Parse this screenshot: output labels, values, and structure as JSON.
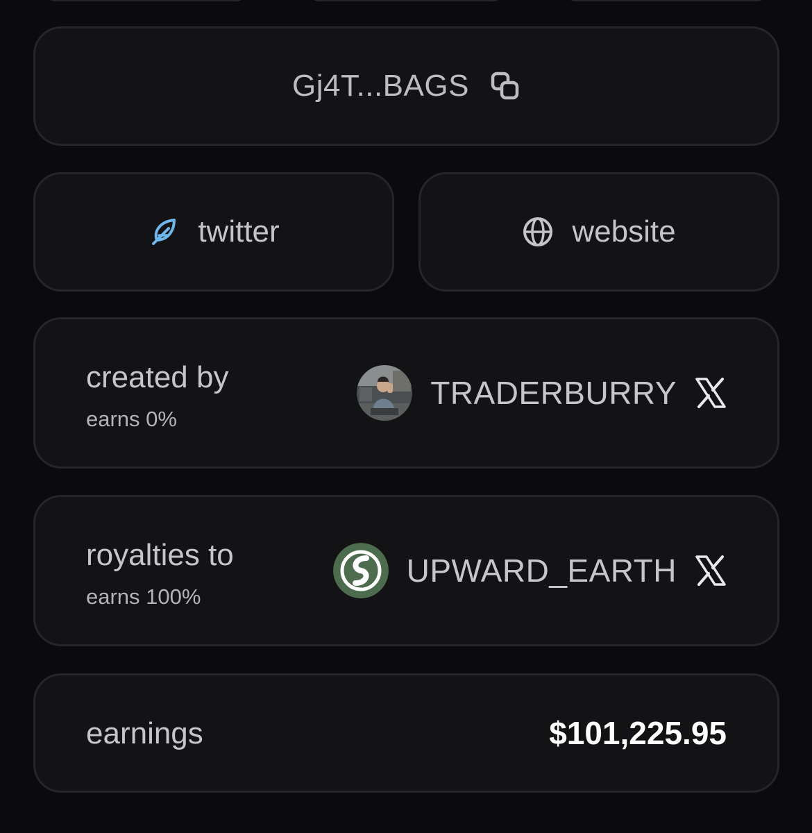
{
  "address": {
    "short": "Gj4T...BAGS",
    "copy_icon": "copy-icon"
  },
  "links": {
    "twitter": {
      "label": "twitter",
      "icon": "feather-icon",
      "icon_color": "#6fb7ea"
    },
    "website": {
      "label": "website",
      "icon": "globe-icon"
    }
  },
  "creator": {
    "role_label": "created by",
    "earns": "earns 0%",
    "username": "TRADERBURRY",
    "social_icon": "x-icon"
  },
  "royalties": {
    "role_label": "royalties to",
    "earns": "earns 100%",
    "username": "UPWARD_EARTH",
    "avatar_color": "#4d6b4d",
    "social_icon": "x-icon"
  },
  "earnings": {
    "label": "earnings",
    "value": "$101,225.95"
  },
  "colors": {
    "background": "#0b0b0d",
    "card": "#131315",
    "card_border": "#26262a",
    "text": "#c6c6c9",
    "value": "#ffffff"
  }
}
